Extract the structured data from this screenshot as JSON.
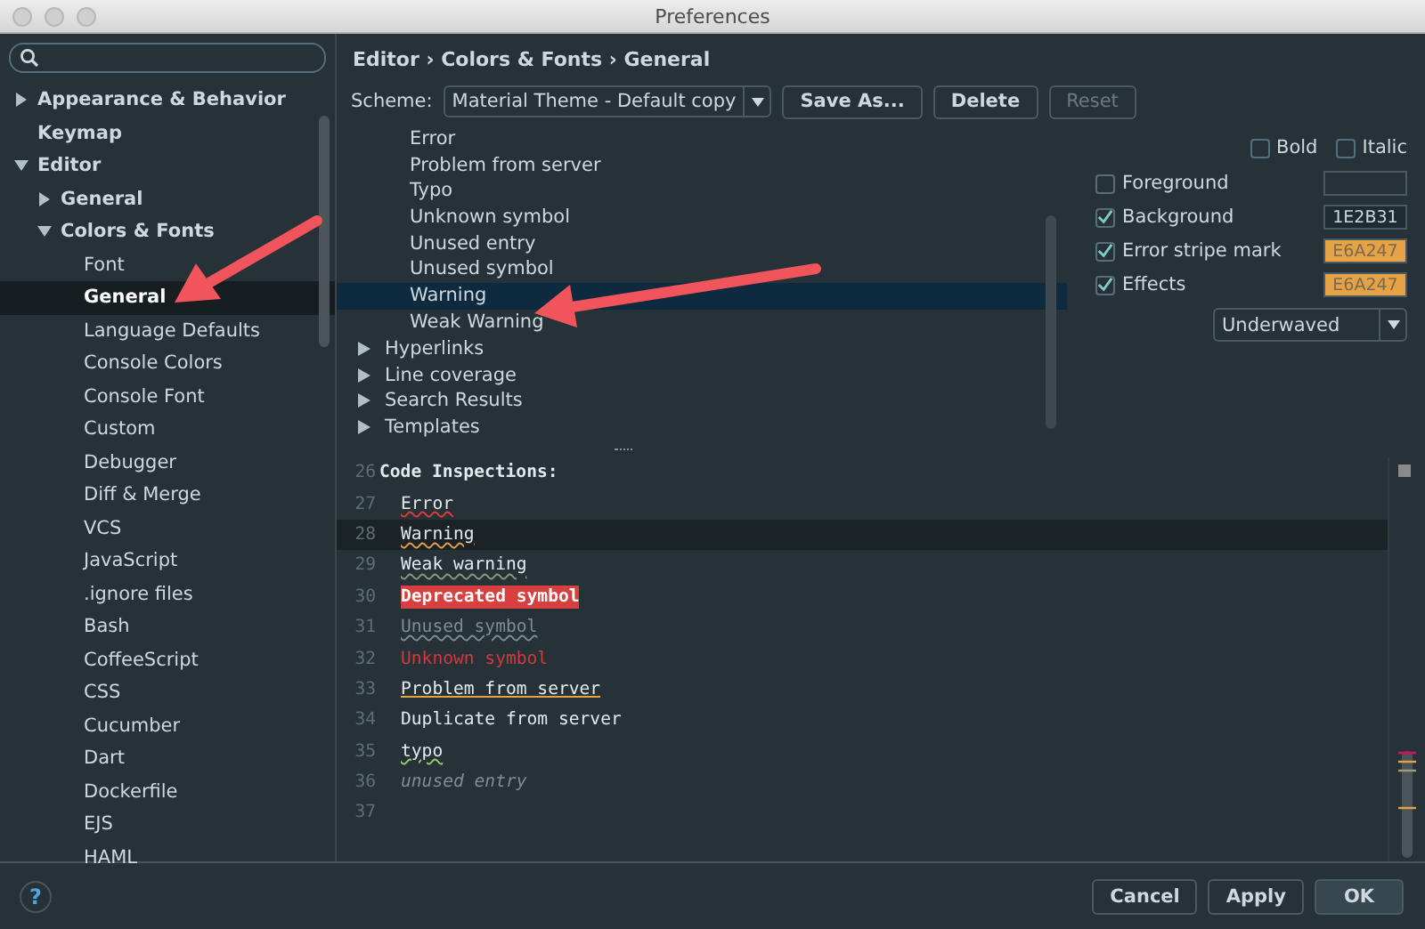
{
  "window": {
    "title": "Preferences"
  },
  "tree": [
    {
      "label": "Appearance & Behavior",
      "expanded": false,
      "selected": false
    },
    {
      "label": "Keymap",
      "selected": false
    },
    {
      "label": "Editor",
      "expanded": true,
      "selected": false,
      "children": [
        {
          "label": "General",
          "expanded": false,
          "selected": false
        },
        {
          "label": "Colors & Fonts",
          "expanded": true,
          "selected": false,
          "children": [
            {
              "label": "Font",
              "selected": false
            },
            {
              "label": "General",
              "selected": true
            },
            {
              "label": "Language Defaults",
              "selected": false
            },
            {
              "label": "Console Colors",
              "selected": false
            },
            {
              "label": "Console Font",
              "selected": false
            },
            {
              "label": "Custom",
              "selected": false
            },
            {
              "label": "Debugger",
              "selected": false
            },
            {
              "label": "Diff & Merge",
              "selected": false
            },
            {
              "label": "VCS",
              "selected": false
            },
            {
              "label": "JavaScript",
              "selected": false
            },
            {
              "label": ".ignore files",
              "selected": false
            },
            {
              "label": "Bash",
              "selected": false
            },
            {
              "label": "CoffeeScript",
              "selected": false
            },
            {
              "label": "CSS",
              "selected": false
            },
            {
              "label": "Cucumber",
              "selected": false
            },
            {
              "label": "Dart",
              "selected": false
            },
            {
              "label": "Dockerfile",
              "selected": false
            },
            {
              "label": "EJS",
              "selected": false
            },
            {
              "label": "HAML",
              "selected": false
            }
          ]
        }
      ]
    }
  ],
  "breadcrumb": "Editor › Colors & Fonts › General",
  "scheme": {
    "label": "Scheme:",
    "value": "Material Theme - Default copy",
    "buttons": [
      {
        "label": "Save As...",
        "disabled": false
      },
      {
        "label": "Delete",
        "disabled": false
      },
      {
        "label": "Reset",
        "disabled": true
      }
    ]
  },
  "elements": [
    {
      "label": "Error",
      "selected": false
    },
    {
      "label": "Problem from server",
      "selected": false
    },
    {
      "label": "Typo",
      "selected": false
    },
    {
      "label": "Unknown symbol",
      "selected": false
    },
    {
      "label": "Unused entry",
      "selected": false
    },
    {
      "label": "Unused symbol",
      "selected": false
    },
    {
      "label": "Warning",
      "selected": true
    },
    {
      "label": "Weak Warning",
      "selected": false
    }
  ],
  "groups": [
    {
      "label": "Hyperlinks",
      "expanded": false
    },
    {
      "label": "Line coverage",
      "expanded": false
    },
    {
      "label": "Search Results",
      "expanded": false
    },
    {
      "label": "Templates",
      "expanded": false
    }
  ],
  "font_style": [
    {
      "label": "Bold",
      "checked": false
    },
    {
      "label": "Italic",
      "checked": false
    }
  ],
  "attributes": [
    {
      "label": "Foreground",
      "checked": false
    },
    {
      "label": "Background",
      "checked": true,
      "value": "1E2B31",
      "color": "#1e2b31"
    },
    {
      "label": "Error stripe mark",
      "checked": true,
      "value": "E6A247",
      "color": "#e6a247"
    },
    {
      "label": "Effects",
      "checked": true,
      "value": "E6A247",
      "color": "#e6a247"
    }
  ],
  "effect_type": "Underwaved",
  "preview": [
    {
      "line": "26",
      "text": "Code Inspections:",
      "kind": "plain",
      "current": false
    },
    {
      "line": "27",
      "text": "Error",
      "kind": "error",
      "current": false
    },
    {
      "line": "28",
      "text": "Warning",
      "kind": "warning",
      "current": true
    },
    {
      "line": "29",
      "text": "Weak warning",
      "kind": "weak",
      "current": false
    },
    {
      "line": "30",
      "text": "Deprecated symbol",
      "kind": "deprecated",
      "current": false
    },
    {
      "line": "31",
      "text": "Unused symbol",
      "kind": "unused",
      "current": false
    },
    {
      "line": "32",
      "text": "Unknown symbol",
      "kind": "unknown",
      "current": false
    },
    {
      "line": "33",
      "text": "Problem from server",
      "kind": "problem",
      "current": false
    },
    {
      "line": "34",
      "text": "Duplicate from server",
      "kind": "plain",
      "current": false
    },
    {
      "line": "35",
      "text": "typo",
      "kind": "typo",
      "current": false
    },
    {
      "line": "36",
      "text": "unused entry",
      "kind": "entry",
      "current": false
    },
    {
      "line": "37",
      "current": false
    }
  ],
  "footer": {
    "help": "?",
    "buttons": [
      {
        "label": "Cancel",
        "default": false
      },
      {
        "label": "Apply",
        "default": false
      },
      {
        "label": "OK",
        "default": true
      }
    ]
  }
}
